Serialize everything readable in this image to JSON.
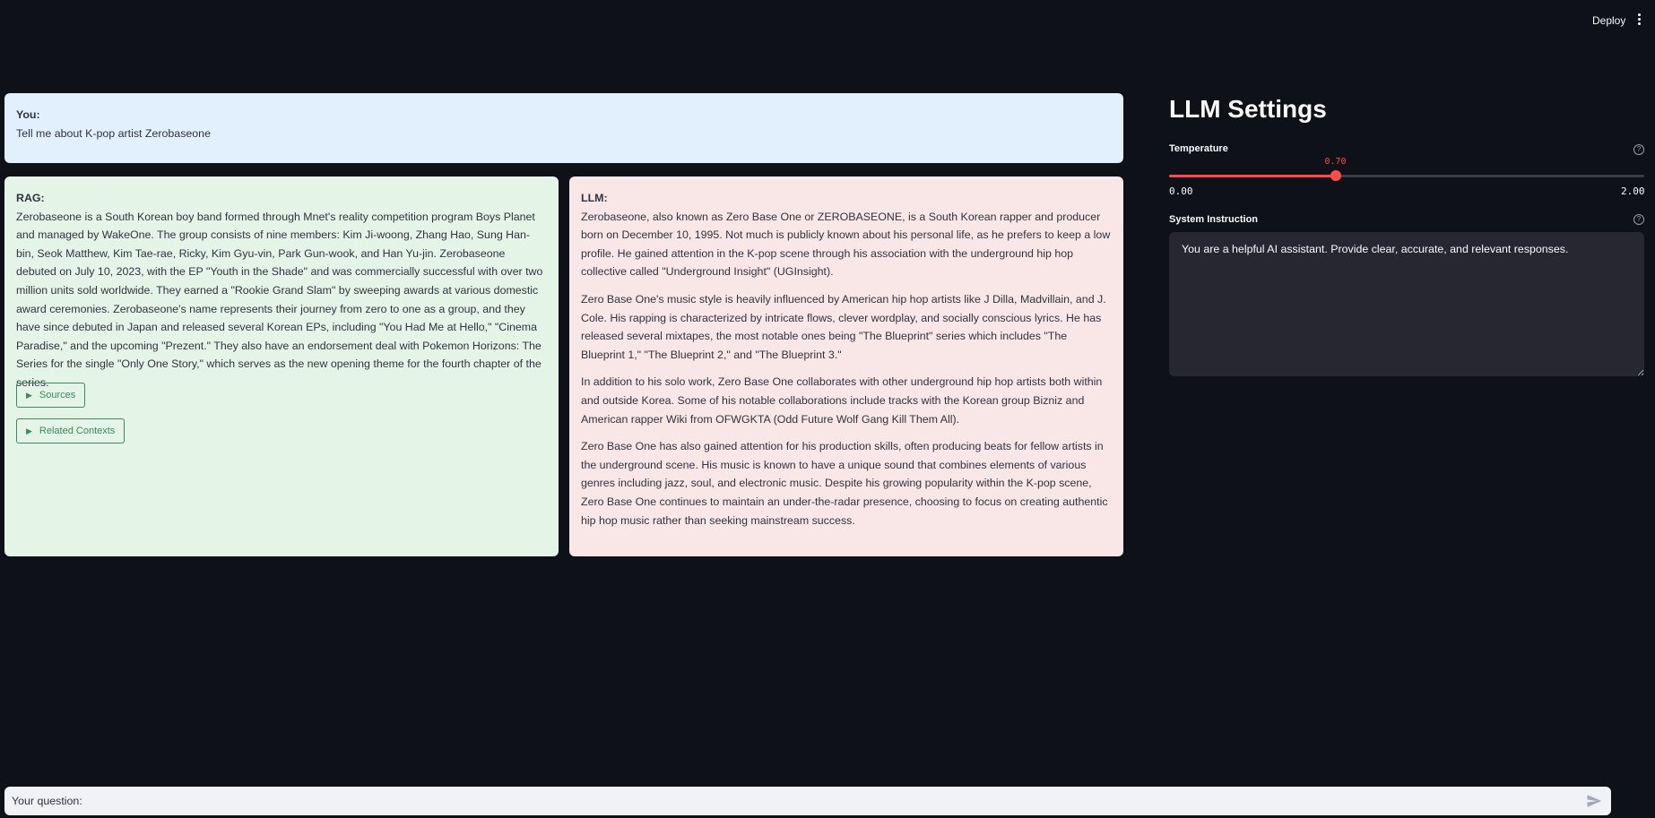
{
  "header": {
    "deploy_label": "Deploy",
    "menu_icon": "more-vertical-icon"
  },
  "user_message": {
    "label": "You:",
    "text": "Tell me about K-pop artist Zerobaseone"
  },
  "rag_response": {
    "label": "RAG:",
    "text": "Zerobaseone is a South Korean boy band formed through Mnet's reality competition program Boys Planet and managed by WakeOne. The group consists of nine members: Kim Ji-woong, Zhang Hao, Sung Han-bin, Seok Matthew, Kim Tae-rae, Ricky, Kim Gyu-vin, Park Gun-wook, and Han Yu-jin. Zerobaseone debuted on July 10, 2023, with the EP \"Youth in the Shade\" and was commercially successful with over two million units sold worldwide. They earned a \"Rookie Grand Slam\" by sweeping awards at various domestic award ceremonies. Zerobaseone's name represents their journey from zero to one as a group, and they have since debuted in Japan and released several Korean EPs, including \"You Had Me at Hello,\" \"Cinema Paradise,\" and the upcoming \"Prezent.\" They also have an endorsement deal with Pokemon Horizons: The Series for the single \"Only One Story,\" which serves as the new opening theme for the fourth chapter of the series.",
    "sources_label": "Sources",
    "related_label": "Related Contexts"
  },
  "llm_response": {
    "label": "LLM:",
    "paragraphs": [
      "Zerobaseone, also known as Zero Base One or ZEROBASEONE, is a South Korean rapper and producer born on December 10, 1995. Not much is publicly known about his personal life, as he prefers to keep a low profile. He gained attention in the K-pop scene through his association with the underground hip hop collective called \"Underground Insight\" (UGInsight).",
      "Zero Base One's music style is heavily influenced by American hip hop artists like J Dilla, Madvillain, and J. Cole. His rapping is characterized by intricate flows, clever wordplay, and socially conscious lyrics. He has released several mixtapes, the most notable ones being \"The Blueprint\" series which includes \"The Blueprint 1,\" \"The Blueprint 2,\" and \"The Blueprint 3.\"",
      "In addition to his solo work, Zero Base One collaborates with other underground hip hop artists both within and outside Korea. Some of his notable collaborations include tracks with the Korean group Bizniz and American rapper Wiki from OFWGKTA (Odd Future Wolf Gang Kill Them All).",
      "Zero Base One has also gained attention for his production skills, often producing beats for fellow artists in the underground scene. His music is known to have a unique sound that combines elements of various genres including jazz, soul, and electronic music. Despite his growing popularity within the K-pop scene, Zero Base One continues to maintain an under-the-radar presence, choosing to focus on creating authentic hip hop music rather than seeking mainstream success."
    ]
  },
  "settings": {
    "title": "LLM Settings",
    "temperature": {
      "label": "Temperature",
      "value": "0.70",
      "min": "0.00",
      "max": "2.00",
      "value_fraction": 0.35
    },
    "system_instruction": {
      "label": "System Instruction",
      "value": "You are a helpful AI assistant. Provide clear, accurate, and relevant responses."
    }
  },
  "chat_input": {
    "placeholder": "Your question:",
    "send_icon": "send-icon"
  },
  "colors": {
    "background": "#0e1117",
    "user_card": "#e2effd",
    "rag_card": "#e4f4e6",
    "llm_card": "#f9e6e6",
    "accent": "#ff4b4b"
  }
}
